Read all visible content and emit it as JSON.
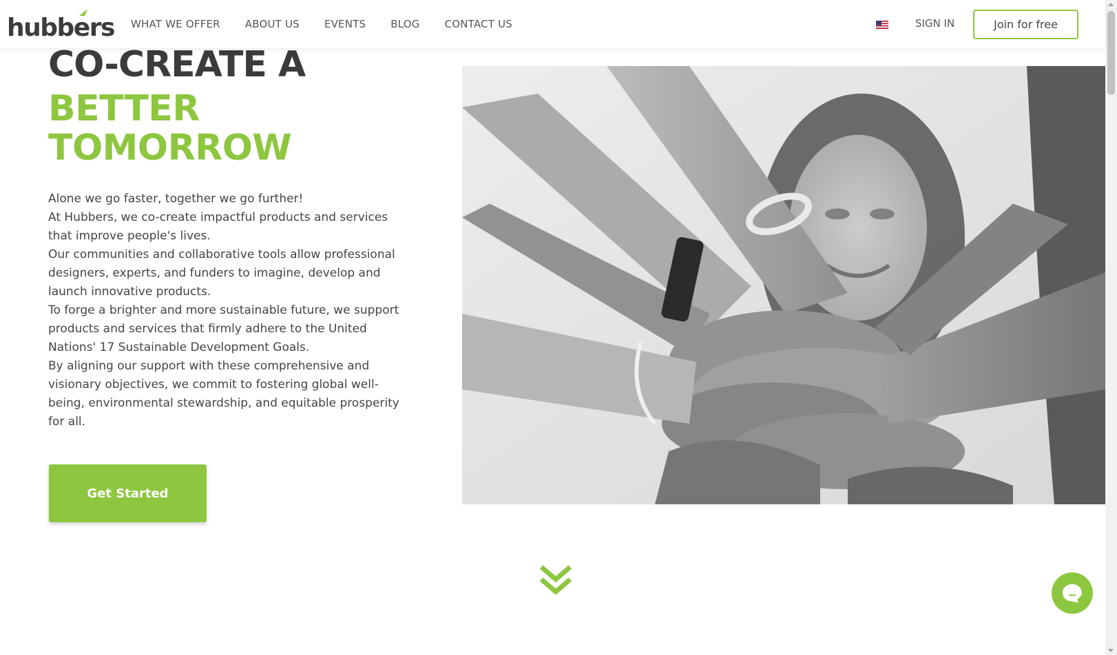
{
  "header": {
    "logo_text": "hubbers",
    "nav": [
      "WHAT WE OFFER",
      "ABOUT US",
      "EVENTS",
      "BLOG",
      "CONTACT US"
    ],
    "language_icon": "us-flag-icon",
    "sign_in": "SIGN IN",
    "join": "Join for free"
  },
  "hero": {
    "title_line1": "CO-CREATE A",
    "title_line2": "BETTER",
    "title_line3": "TOMORROW",
    "paragraphs": [
      "Alone we go faster, together we go further!",
      "At Hubbers, we co-create impactful products and services that improve people's lives.",
      "Our communities and collaborative tools allow professional designers, experts, and funders to imagine, develop and launch innovative products.",
      "To forge a brighter and more sustainable future, we support products and services that firmly adhere to the United Nations' 17 Sustainable Development Goals.",
      "By aligning our support with these comprehensive and visionary objectives, we commit to fostering global well-being, environmental stewardship, and equitable prosperity for all."
    ],
    "cta": "Get Started"
  },
  "colors": {
    "accent": "#8dc63f",
    "heading": "#3b3b3b",
    "text": "#444444"
  },
  "icons": {
    "scroll_down": "double-chevron-down-icon",
    "chat": "chat-bubble-icon"
  }
}
